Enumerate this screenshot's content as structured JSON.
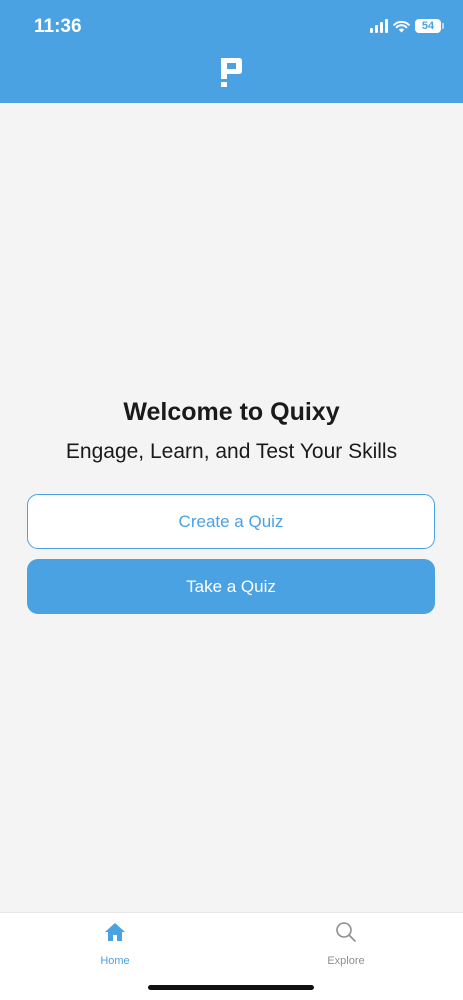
{
  "status_bar": {
    "time": "11:36",
    "battery": "54"
  },
  "colors": {
    "accent": "#4aa2e2",
    "background": "#f4f4f4",
    "text": "#1a1a1a"
  },
  "header": {
    "logo_icon": "quixy-logo-icon"
  },
  "main": {
    "title": "Welcome to Quixy",
    "subtitle": "Engage, Learn, and Test Your Skills",
    "create_button": "Create a Quiz",
    "take_button": "Take a Quiz"
  },
  "tabs": [
    {
      "label": "Home",
      "icon": "home-icon",
      "active": true
    },
    {
      "label": "Explore",
      "icon": "search-icon",
      "active": false
    }
  ]
}
